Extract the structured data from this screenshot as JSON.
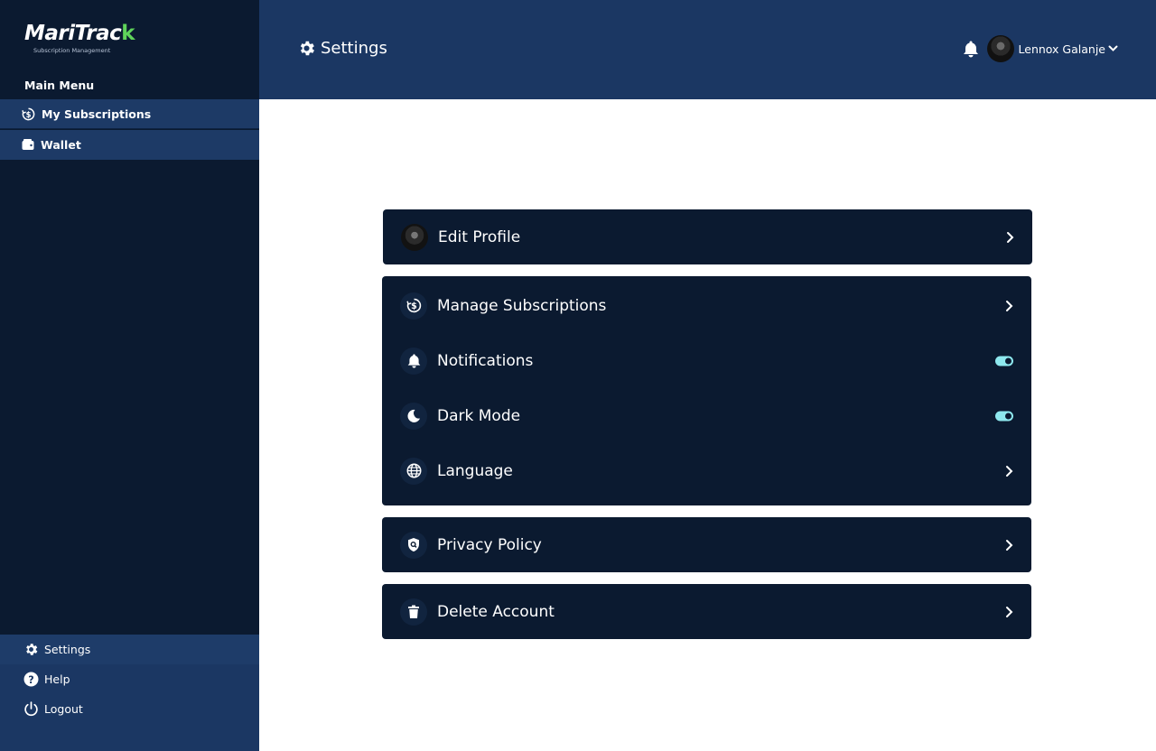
{
  "app": {
    "logo_main": "MariTrac",
    "logo_check": "k",
    "logo_sub": "Subscription Management"
  },
  "sidebar": {
    "section_title": "Main Menu",
    "items": [
      {
        "label": "My Subscriptions",
        "icon": "subscription-dollar-icon"
      },
      {
        "label": "Wallet",
        "icon": "wallet-icon"
      }
    ],
    "bottom": [
      {
        "label": "Settings",
        "icon": "gear-icon"
      },
      {
        "label": "Help",
        "icon": "help-icon"
      },
      {
        "label": "Logout",
        "icon": "power-icon"
      }
    ]
  },
  "header": {
    "title": "Settings",
    "user_name": "Lennox Galanje"
  },
  "settings": {
    "edit_profile": "Edit Profile",
    "manage_subscriptions": "Manage Subscriptions",
    "notifications": "Notifications",
    "notifications_enabled": true,
    "dark_mode": "Dark Mode",
    "dark_mode_enabled": true,
    "language": "Language",
    "privacy_policy": "Privacy Policy",
    "delete_account": "Delete Account"
  },
  "colors": {
    "sidebar_bg": "#0b1a30",
    "header_bg": "#1b3763",
    "card_bg": "#0b1a30",
    "toggle_on": "#8ee8ee",
    "logo_accent": "#5fd35a"
  }
}
